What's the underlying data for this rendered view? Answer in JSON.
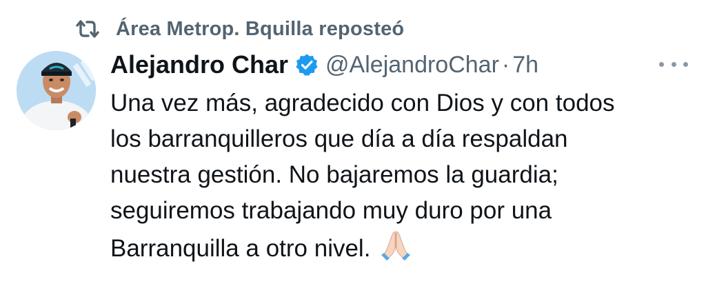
{
  "repost": {
    "icon": "repost-icon",
    "text": "Área Metrop. Bquilla reposteó"
  },
  "author": {
    "name": "Alejandro Char",
    "handle": "@AlejandroChar",
    "separator": "·",
    "time": "7h",
    "verified": true,
    "verified_color": "#1d9bf0"
  },
  "tweet": {
    "lines": [
      "Una vez más, agradecido con Dios y con todos",
      "los barranquilleros que día a día respaldan",
      "nuestra gestión. No bajaremos la guardia;",
      "seguiremos trabajando muy duro por una",
      "Barranquilla a otro nivel."
    ],
    "emoji": "🙏🏻"
  },
  "colors": {
    "text_primary": "#0f1419",
    "text_secondary": "#536471",
    "accent": "#1d9bf0"
  }
}
